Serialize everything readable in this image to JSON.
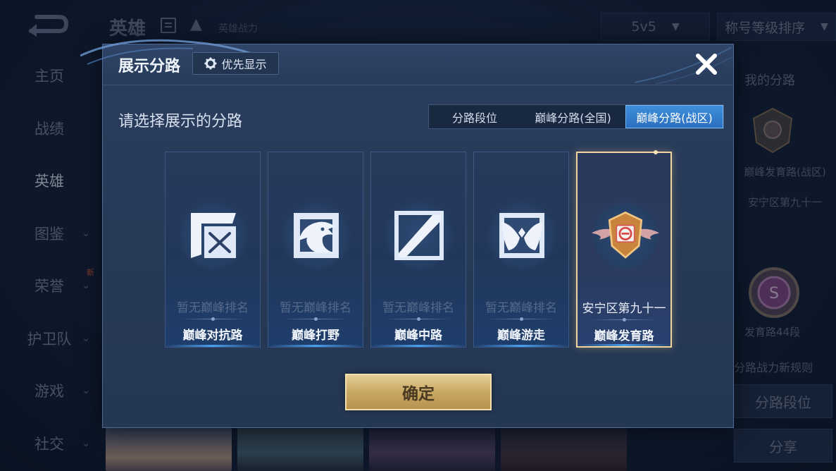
{
  "background": {
    "sidebar": [
      {
        "label": "主页",
        "has_chevron": false
      },
      {
        "label": "战绩",
        "has_chevron": false
      },
      {
        "label": "英雄",
        "has_chevron": false,
        "active": true
      },
      {
        "label": "图鉴",
        "has_chevron": true
      },
      {
        "label": "荣誉",
        "has_chevron": true,
        "badge": "新"
      },
      {
        "label": "护卫队",
        "has_chevron": true
      },
      {
        "label": "游戏",
        "has_chevron": true
      },
      {
        "label": "社交",
        "has_chevron": true
      }
    ],
    "header": {
      "title": "英雄",
      "power_label": "英雄战力",
      "mode_select": "5v5",
      "sort_select": "称号等级排序"
    },
    "right_panel": {
      "title": "我的分路",
      "badge1_text": "巅峰发育路(战区)",
      "badge1_region": "安宁区第九十一",
      "badge2_text": "发育路44段",
      "rule_text": "分路战力新规则",
      "lane_rank_button": "分路段位",
      "share_button": "分享"
    }
  },
  "modal": {
    "title": "展示分路",
    "priority_button": "优先显示",
    "subtitle": "请选择展示的分路",
    "tabs": [
      {
        "label": "分路段位",
        "selected": false
      },
      {
        "label": "巅峰分路(全国)",
        "selected": false
      },
      {
        "label": "巅峰分路(战区)",
        "selected": true
      }
    ],
    "cards": [
      {
        "lane": "巅峰对抗路",
        "rank": "暂无巅峰排名",
        "icon": "clash-lane-icon",
        "selected": false
      },
      {
        "lane": "巅峰打野",
        "rank": "暂无巅峰排名",
        "icon": "jungle-dragon-icon",
        "selected": false
      },
      {
        "lane": "巅峰中路",
        "rank": "暂无巅峰排名",
        "icon": "mid-lane-icon",
        "selected": false
      },
      {
        "lane": "巅峰游走",
        "rank": "暂无巅峰排名",
        "icon": "roam-wings-icon",
        "selected": false
      },
      {
        "lane": "巅峰发育路",
        "rank": "安宁区第九十一",
        "icon": "farm-lane-badge-icon",
        "selected": true
      }
    ],
    "confirm_button": "确定"
  },
  "colors": {
    "accent_blue": "#3e8fdb",
    "confirm_gold": "#c9a864",
    "selected_border": "#f0d49a"
  }
}
